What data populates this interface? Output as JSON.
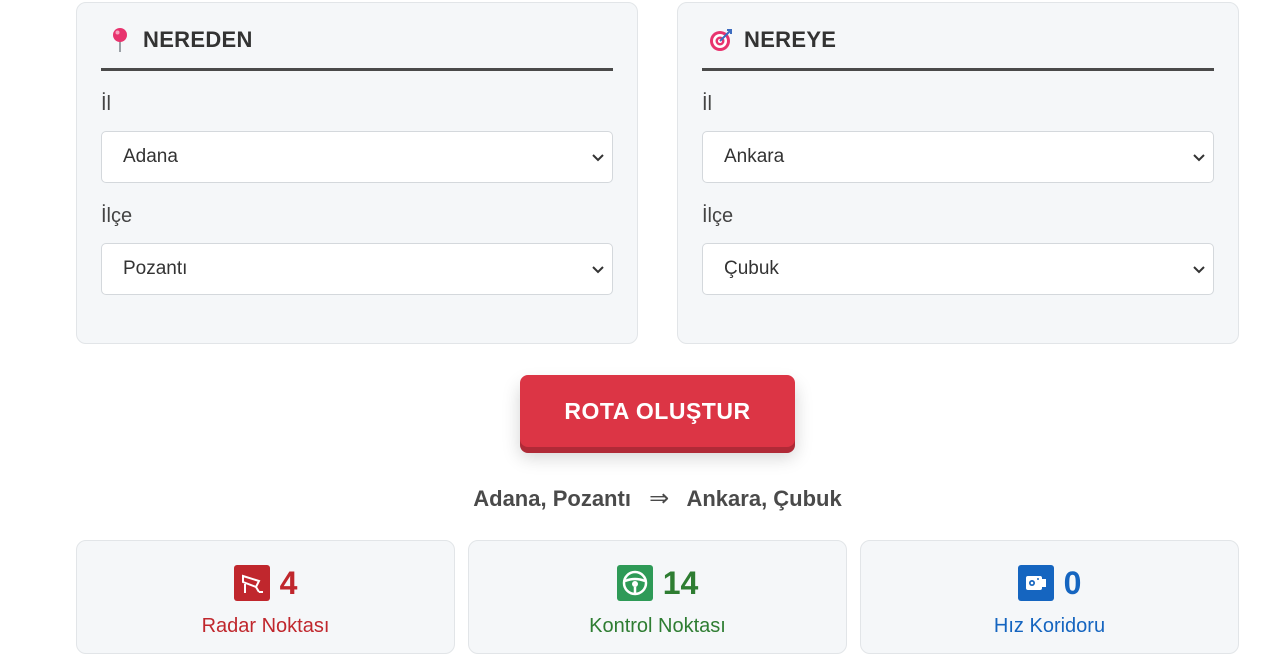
{
  "from": {
    "title": "NEREDEN",
    "icon": "pin-icon",
    "province_label": "İl",
    "province_value": "Adana",
    "district_label": "İlçe",
    "district_value": "Pozantı"
  },
  "to": {
    "title": "NEREYE",
    "icon": "target-icon",
    "province_label": "İl",
    "province_value": "Ankara",
    "district_label": "İlçe",
    "district_value": "Çubuk"
  },
  "route_button": "ROTA OLUŞTUR",
  "summary": {
    "origin": "Adana, Pozantı",
    "arrow": "⇒",
    "destination": "Ankara, Çubuk"
  },
  "stats": [
    {
      "icon": "radar-camera-icon",
      "value": "4",
      "label": "Radar Noktası",
      "color": "#c0272d"
    },
    {
      "icon": "steering-wheel-icon",
      "value": "14",
      "label": "Kontrol Noktası",
      "color": "#2e7d32"
    },
    {
      "icon": "speed-camera-icon",
      "value": "0",
      "label": "Hız Koridoru",
      "color": "#1565c0"
    }
  ]
}
